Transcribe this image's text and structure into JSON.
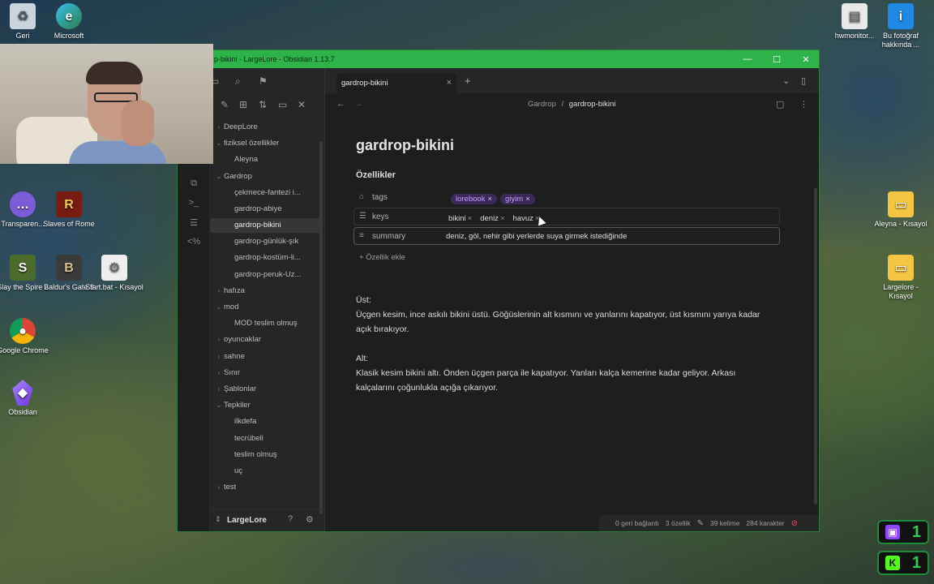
{
  "desktop": {
    "icons": [
      {
        "label": "Geri",
        "icon": "recycle-bin-icon"
      },
      {
        "label": "Microsoft",
        "icon": "edge-icon"
      },
      {
        "label": "hwmonitor...",
        "icon": "file-icon"
      },
      {
        "label": "Bu fotoğraf hakkında ...",
        "icon": "info-icon"
      },
      {
        "label": "Transparen...",
        "icon": "chat-icon"
      },
      {
        "label": "Slaves of Rome",
        "icon": "game-icon"
      },
      {
        "label": "Aleyna - Kısayol",
        "icon": "folder-icon"
      },
      {
        "label": "Largelore - Kısayol",
        "icon": "folder-icon"
      },
      {
        "label": "Slay the Spire 2",
        "icon": "game-icon"
      },
      {
        "label": "Baldur's Gate 3",
        "icon": "game-icon"
      },
      {
        "label": "Start.bat - Kısayol",
        "icon": "gear-file-icon"
      },
      {
        "label": "Google Chrome",
        "icon": "chrome-icon"
      },
      {
        "label": "Obsidian",
        "icon": "obsidian-icon"
      }
    ],
    "counters": [
      {
        "value": "1",
        "icon": "twitch-icon",
        "color": "#9146ff"
      },
      {
        "value": "1",
        "icon": "kick-icon",
        "color": "#53fc18"
      }
    ]
  },
  "window": {
    "title": "p-bikini - LargeLore - Obsidian 1.13.7",
    "accent": "#2db34a"
  },
  "sidebar": {
    "tree": [
      {
        "label": "DeepLore",
        "type": "folder",
        "state": "collapsed"
      },
      {
        "label": "fiziksel özellikler",
        "type": "folder",
        "state": "expanded"
      },
      {
        "label": "Aleyna",
        "type": "file"
      },
      {
        "label": "Gardrop",
        "type": "folder",
        "state": "expanded"
      },
      {
        "label": "çekmece-fantezi i...",
        "type": "file"
      },
      {
        "label": "gardrop-abiye",
        "type": "file"
      },
      {
        "label": "gardrop-bikini",
        "type": "file",
        "active": true
      },
      {
        "label": "gardrop-günlük-şık",
        "type": "file"
      },
      {
        "label": "gardrop-kostüm-li...",
        "type": "file"
      },
      {
        "label": "gardrop-peruk-Uz...",
        "type": "file"
      },
      {
        "label": "hafıza",
        "type": "folder",
        "state": "collapsed"
      },
      {
        "label": "mod",
        "type": "folder",
        "state": "expanded"
      },
      {
        "label": "MOD teslim olmuş",
        "type": "file"
      },
      {
        "label": "oyuncaklar",
        "type": "folder",
        "state": "collapsed"
      },
      {
        "label": "sahne",
        "type": "folder",
        "state": "collapsed"
      },
      {
        "label": "Sınır",
        "type": "folder",
        "state": "collapsed"
      },
      {
        "label": "Şablonlar",
        "type": "folder",
        "state": "collapsed"
      },
      {
        "label": "Tepkiler",
        "type": "folder",
        "state": "expanded"
      },
      {
        "label": "ilkdefa",
        "type": "file"
      },
      {
        "label": "tecrübeli",
        "type": "file"
      },
      {
        "label": "teslim olmuş",
        "type": "file"
      },
      {
        "label": "uç",
        "type": "file"
      },
      {
        "label": "test",
        "type": "folder",
        "state": "collapsed"
      }
    ],
    "vault_name": "LargeLore"
  },
  "tabs": [
    {
      "label": "gardrop-bikini"
    }
  ],
  "breadcrumb": {
    "folder": "Gardrop",
    "separator": "/",
    "file": "gardrop-bikini"
  },
  "note": {
    "title": "gardrop-bikini",
    "properties_heading": "Özellikler",
    "properties": {
      "tags": {
        "key": "tags",
        "values": [
          "lorebook",
          "giyim"
        ]
      },
      "keys": {
        "key": "keys",
        "values": [
          "bikini",
          "deniz",
          "havuz"
        ]
      },
      "summary": {
        "key": "summary",
        "value": "deniz, göl, nehir gibi yerlerde suya girmek istediğinde"
      }
    },
    "add_property_label": "Özellik ekle",
    "body": [
      "Üst:",
      "Üçgen kesim, ince askılı bikini üstü. Göğüslerinin alt kısmını ve yanlarını kapatıyor, üst kısmını yarıya kadar açık bırakıyor.",
      "Alt:",
      "Klasik kesim bikini altı. Önden üçgen parça ile kapatıyor. Yanları kalça kemerine kadar geliyor. Arkası kalçalarını çoğunlukla açığa çıkarıyor."
    ]
  },
  "status": {
    "backlinks": "0 geri bağlantı",
    "props": "3 özellik",
    "words": "39 kelime",
    "chars": "284 karakter"
  }
}
